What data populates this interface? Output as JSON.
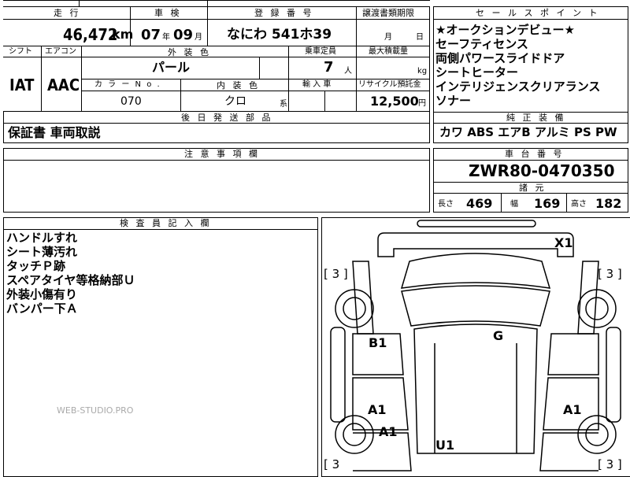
{
  "row1": {
    "headers": {
      "mileage": "走 行",
      "inspection": "車 検",
      "registration": "登 録 番 号",
      "transfer_deadline": "譲渡書類期限"
    },
    "mileage_value": "46,472",
    "mileage_unit": "km",
    "inspection_year": "07",
    "inspection_year_unit": "年",
    "inspection_month": "09",
    "inspection_month_unit": "月",
    "registration_value": "なにわ 541ホ39",
    "transfer_month_unit": "月",
    "transfer_day_unit": "日"
  },
  "row2": {
    "headers": {
      "shift": "シフト",
      "aircon": "エアコン",
      "exterior_color": "外 装 色",
      "capacity": "乗車定員",
      "max_load": "最大積載量"
    },
    "shift_value": "IAT",
    "aircon_value": "AAC",
    "exterior_color_value": "パール",
    "capacity_value": "7",
    "capacity_unit": "人",
    "max_load_unit": "kg"
  },
  "row3": {
    "headers": {
      "color_no": "カ ラ ー N o .",
      "interior_color": "内 装 色",
      "import": "輸 入 車",
      "recycle": "リサイクル預託金"
    },
    "color_no_value": "070",
    "interior_color_value": "クロ",
    "interior_suffix": "系",
    "recycle_value": "12,500",
    "recycle_unit": "円"
  },
  "later_parts": {
    "header": "後 日 発 送 部 品",
    "value": "保証書 車両取説"
  },
  "notes": {
    "header": "注 意 事 項 欄"
  },
  "selling_points": {
    "header": "セ ー ル ス ポ イ ン ト",
    "items": [
      "★オークションデビュー★",
      "セーフティセンス",
      "両側パワースライドドア",
      "シートヒーター",
      "インテリジェンスクリアランス",
      "ソナー"
    ]
  },
  "equipment": {
    "header": "純 正 装 備",
    "value": "カワ ABS エアB アルミ PS PW"
  },
  "chassis": {
    "header": "車 台 番 号",
    "value": "ZWR80-0470350"
  },
  "specs": {
    "header": "諸 元",
    "length_label": "長さ",
    "length": "469",
    "width_label": "幅",
    "width": "169",
    "height_label": "高さ",
    "height": "182"
  },
  "inspector": {
    "header": "検 査 員 記 入 欄",
    "lines": [
      "ハンドルすれ",
      "シート薄汚れ",
      "タッチＰ跡",
      "スペアタイヤ等格納部Ｕ",
      "外装小傷有り",
      "バンパー下Ａ"
    ]
  },
  "watermark": "WEB-STUDIO.PRO",
  "diagram": {
    "marks": {
      "x1": "X1",
      "b1": "B1",
      "g": "G",
      "a1_left": "A1",
      "a1_right": "A1",
      "a1_lower": "A1",
      "u1": "U1"
    },
    "tire_tl": "[ 3 ]",
    "tire_tr": "[ 3 ]",
    "tire_bl": "[ 3",
    "tire_br": "[ 3 ]"
  }
}
